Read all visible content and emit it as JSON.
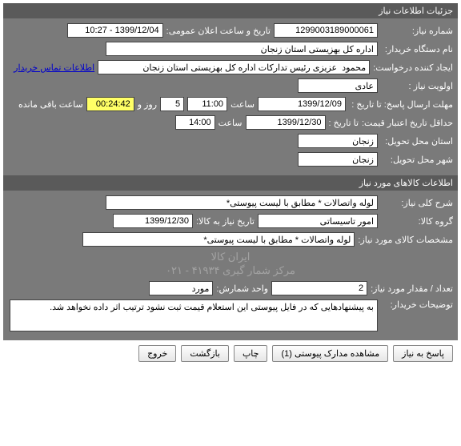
{
  "section1": {
    "header": "جزئیات اطلاعات نیاز",
    "need_no_label": "شماره نیاز:",
    "need_no": "1299003189000061",
    "announce_label": "تاریخ و ساعت اعلان عمومی:",
    "announce_value": "1399/12/04 - 10:27",
    "buyer_org_label": "نام دستگاه خریدار:",
    "buyer_org": "اداره کل بهزیستی استان زنجان",
    "creator_label": "ایجاد کننده درخواست:",
    "creator": "محمود  عزیزی رئیس تدارکات اداره کل بهزیستی استان زنجان",
    "contact_link": "اطلاعات تماس خریدار",
    "priority_label": "اولویت نیاز :",
    "priority": "عادی",
    "deadline_label": "مهلت ارسال پاسخ:  تا تاریخ :",
    "deadline_date": "1399/12/09",
    "time_label": "ساعت",
    "deadline_time": "11:00",
    "days_value": "5",
    "days_label": "روز و",
    "countdown": "00:24:42",
    "countdown_suffix": "ساعت باقی مانده",
    "min_valid_label": "حداقل تاریخ اعتبار قیمت:",
    "to_date_label": "تا تاریخ :",
    "valid_date": "1399/12/30",
    "valid_time": "14:00",
    "delivery_province_label": "استان محل تحویل:",
    "delivery_province": "زنجان",
    "delivery_city_label": "شهر محل تحویل:",
    "delivery_city": "زنجان"
  },
  "section2": {
    "header": "اطلاعات کالاهای مورد نیاز",
    "desc_label": "شرح کلی نیاز:",
    "desc": "لوله واتصالات * مطابق با لیست پیوستی*",
    "group_label": "گروه کالا:",
    "group": "امور تاسیساتی",
    "need_by_label": "تاریخ نیاز به کالا:",
    "need_by": "1399/12/30",
    "item_spec_label": "مشخصات کالای مورد نیاز:",
    "item_spec": "لوله واتصالات * مطابق با لیست پیوستی*",
    "watermark1": "ایران کالا",
    "watermark2": "مرکز شمار گیری ۴۱۹۳۴ - ۰۲۱",
    "qty_label": "تعداد / مقدار مورد نیاز:",
    "qty": "2",
    "unit_label": "واحد شمارش:",
    "unit": "مورد",
    "buyer_notes_label": "توضیحات خریدار:",
    "buyer_notes": "به پیشنهادهایی که در فایل پیوستی این استعلام قیمت ثبت نشود ترتیب اثر داده نخواهد شد."
  },
  "buttons": {
    "reply": "پاسخ به نیاز",
    "attachments": "مشاهده مدارک پیوستی (1)",
    "print": "چاپ",
    "back": "بازگشت",
    "exit": "خروج"
  }
}
